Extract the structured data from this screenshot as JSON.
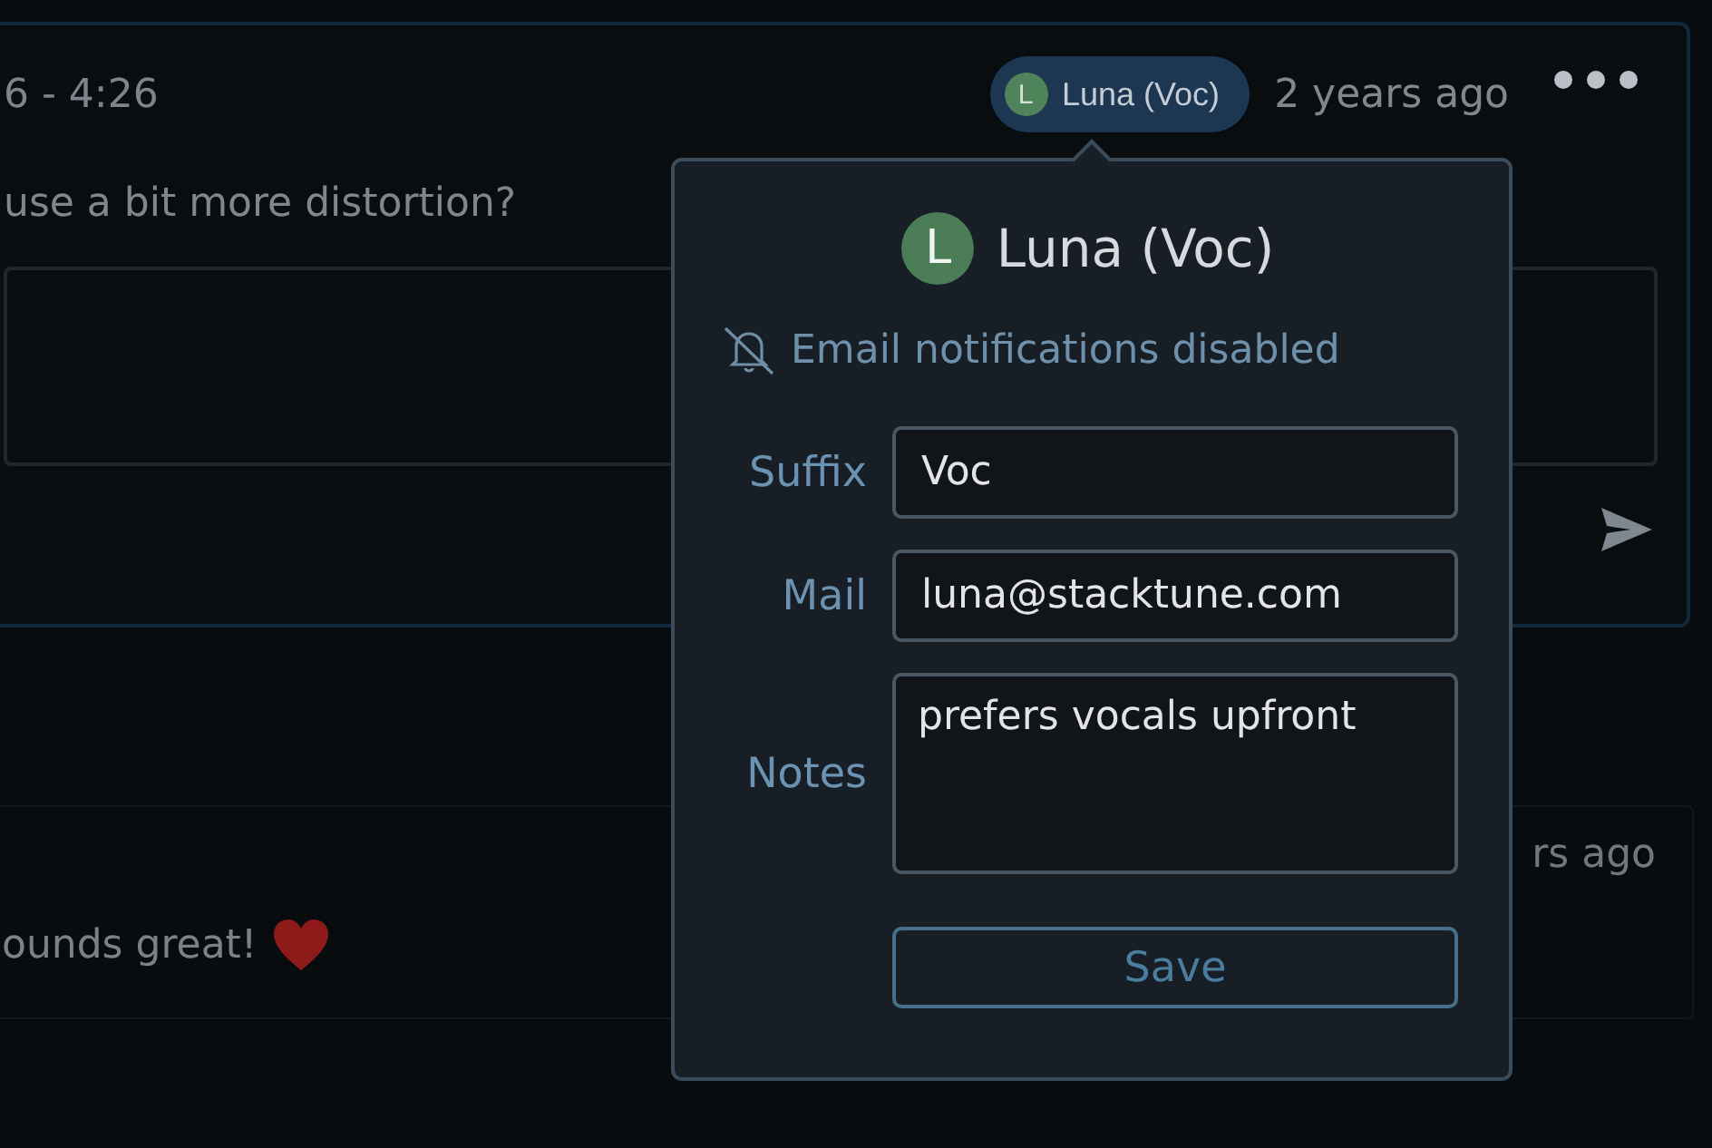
{
  "comment": {
    "time_range": "6 - 4:26",
    "author_chip": {
      "initial": "L",
      "name": "Luna (Voc)"
    },
    "age": "2 years ago",
    "message": "use a bit more distortion?"
  },
  "second_comment": {
    "age": "rs ago",
    "message": "ounds great!"
  },
  "popover": {
    "initial": "L",
    "name": "Luna (Voc)",
    "notice": "Email notifications disabled",
    "fields": [
      {
        "label": "Suffix",
        "value": "Voc",
        "kind": "text"
      },
      {
        "label": "Mail",
        "value": "luna@stacktune.com",
        "kind": "text"
      },
      {
        "label": "Notes",
        "value": "prefers vocals upfront",
        "kind": "textarea"
      }
    ],
    "save_label": "Save"
  }
}
